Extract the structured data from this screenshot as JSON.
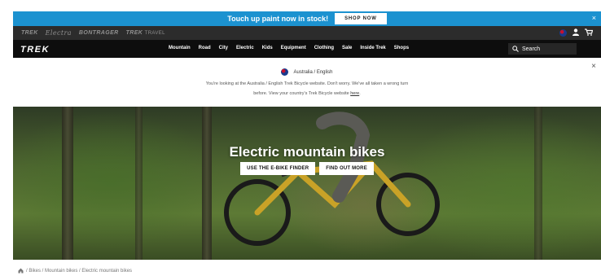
{
  "promo": {
    "text": "Touch up paint now in stock!",
    "button": "SHOP NOW",
    "close": "×"
  },
  "brands": {
    "items": [
      "TREK",
      "Electra",
      "BONTRAGER",
      "TREK",
      "TRAVEL"
    ]
  },
  "header": {
    "logo": "TREK",
    "menu": [
      "Mountain",
      "Road",
      "City",
      "Electric",
      "Kids",
      "Equipment",
      "Clothing",
      "Sale",
      "Inside Trek",
      "Shops"
    ],
    "search_placeholder": "Search"
  },
  "locale": {
    "title": "Australia / English",
    "line1": "You're looking at the Australia / English Trek Bicycle website. Don't worry. We've all taken a wrong turn",
    "line2": "before. View your country's Trek Bicycle website",
    "link": "here",
    "close": "×"
  },
  "hero": {
    "title": "Electric mountain bikes",
    "button1": "USE THE E-BIKE FINDER",
    "button2": "FIND OUT MORE"
  },
  "breadcrumb": {
    "text": "/ Bikes / Mountain bikes / Electric mountain bikes"
  },
  "colors": {
    "promo_bg": "#1c92d0",
    "brand_bar": "#2c2c2c",
    "nav_bg": "#0d0d0d"
  }
}
